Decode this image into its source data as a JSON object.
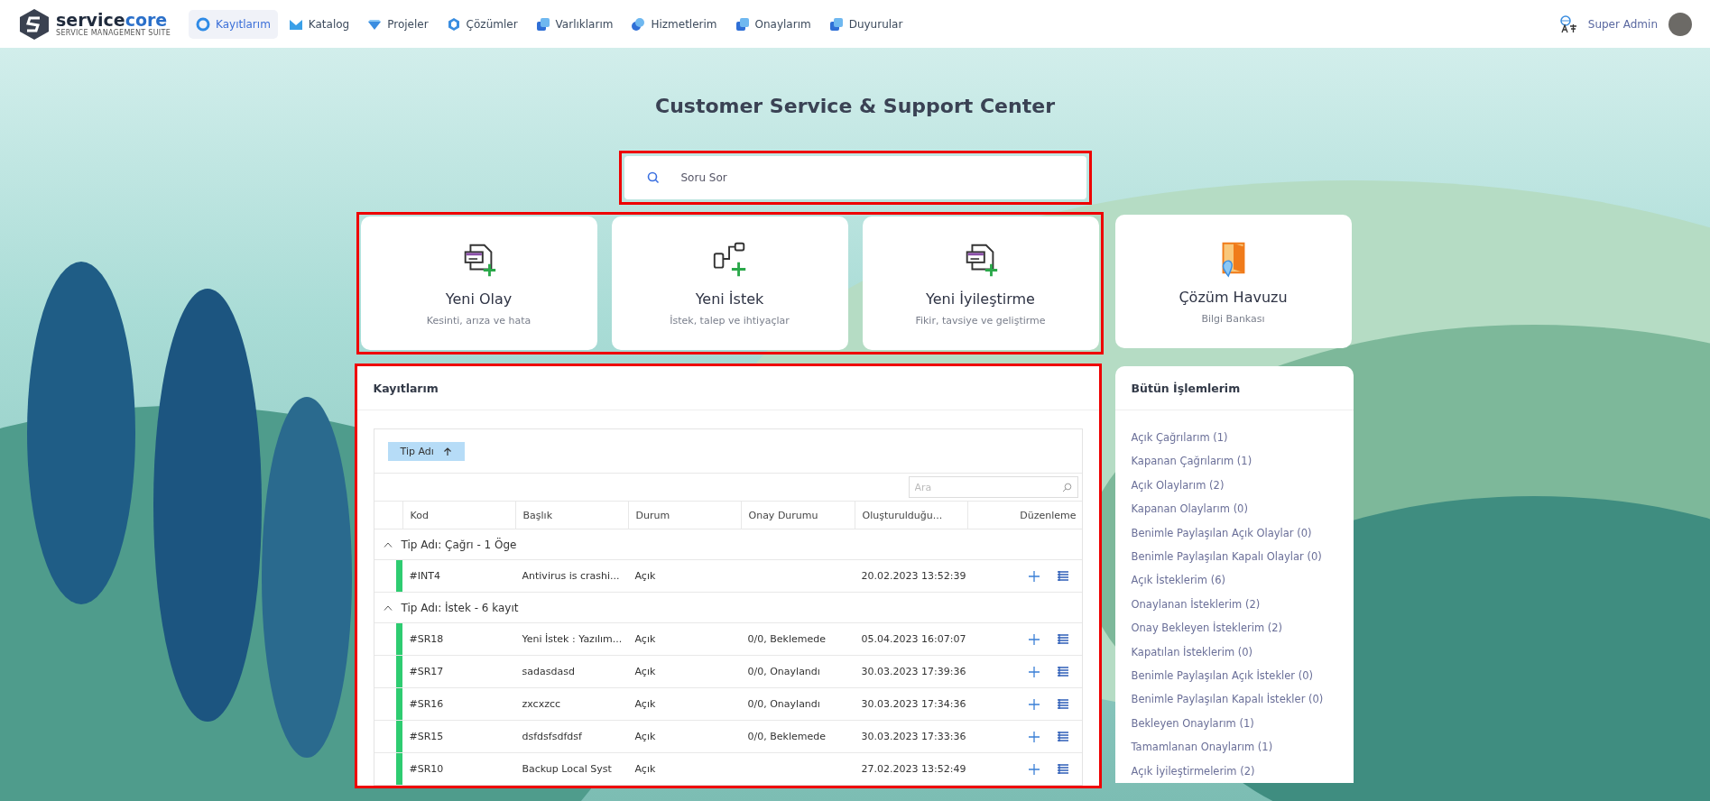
{
  "brand": {
    "name_a": "service",
    "name_b": "core",
    "tagline": "SERVICE MANAGEMENT SUITE"
  },
  "nav": [
    {
      "label": "Kayıtlarım",
      "selected": true,
      "kind": "ring"
    },
    {
      "label": "Katalog",
      "selected": false,
      "kind": "envelope"
    },
    {
      "label": "Projeler",
      "selected": false,
      "kind": "diamond"
    },
    {
      "label": "Çözümler",
      "selected": false,
      "kind": "hexagon"
    },
    {
      "label": "Varlıklarım",
      "selected": false,
      "kind": "stack"
    },
    {
      "label": "Hizmetlerim",
      "selected": false,
      "kind": "drops"
    },
    {
      "label": "Onaylarım",
      "selected": false,
      "kind": "stack"
    },
    {
      "label": "Duyurular",
      "selected": false,
      "kind": "stack"
    }
  ],
  "user": {
    "name": "Super Admin"
  },
  "title": "Customer Service & Support Center",
  "search": {
    "placeholder": "Soru Sor",
    "highlighted": true
  },
  "cards_highlighted": true,
  "cards": [
    {
      "title": "Yeni Olay",
      "subtitle": "Kesinti, arıza ve hata",
      "kind": "form"
    },
    {
      "title": "Yeni İstek",
      "subtitle": "İstek, talep ve ihtiyaçlar",
      "kind": "flow"
    },
    {
      "title": "Yeni İyileştirme",
      "subtitle": "Fikir, tavsiye ve geliştirme",
      "kind": "form"
    },
    {
      "title": "Çözüm Havuzu",
      "subtitle": "Bilgi Bankası",
      "kind": "folder"
    }
  ],
  "records": {
    "title": "Kayıtlarım",
    "highlighted": true,
    "group_chip": "Tip Adı",
    "grid_search": {
      "placeholder": "Ara"
    },
    "columns": [
      "Kod",
      "Başlık",
      "Durum",
      "Onay Durumu",
      "Oluşturulduğu...",
      "Düzenleme"
    ],
    "groups": [
      {
        "label": "Tip Adı: Çağrı - 1 Öge",
        "expanded": true,
        "rows": [
          {
            "code": "#INT4",
            "title": "Antivirus is crashi...",
            "status": "Açık",
            "approval": "",
            "created": "20.02.2023 13:52:39",
            "color": "#2ecc71"
          }
        ]
      },
      {
        "label": "Tip Adı: İstek - 6 kayıt",
        "expanded": true,
        "rows": [
          {
            "code": "#SR18",
            "title": "Yeni İstek : Yazılım...",
            "status": "Açık",
            "approval": "0/0, Beklemede",
            "created": "05.04.2023 16:07:07",
            "color": "#2ecc71"
          },
          {
            "code": "#SR17",
            "title": "sadasdasd",
            "status": "Açık",
            "approval": "0/0, Onaylandı",
            "created": "30.03.2023 17:39:36",
            "color": "#2ecc71"
          },
          {
            "code": "#SR16",
            "title": "zxcxzcc",
            "status": "Açık",
            "approval": "0/0, Onaylandı",
            "created": "30.03.2023 17:34:36",
            "color": "#2ecc71"
          },
          {
            "code": "#SR15",
            "title": "dsfdsfsdfdsf",
            "status": "Açık",
            "approval": "0/0, Beklemede",
            "created": "30.03.2023 17:33:36",
            "color": "#2ecc71"
          },
          {
            "code": "#SR10",
            "title": "Backup Local Syst",
            "status": "Açık",
            "approval": "",
            "created": "27.02.2023 13:52:49",
            "color": "#2ecc71"
          }
        ]
      }
    ]
  },
  "actions": {
    "title": "Bütün İşlemlerim",
    "items": [
      "Açık Çağrılarım (1)",
      "Kapanan Çağrılarım (1)",
      "Açık Olaylarım (2)",
      "Kapanan Olaylarım (0)",
      "Benimle Paylaşılan Açık Olaylar (0)",
      "Benimle Paylaşılan Kapalı Olaylar (0)",
      "Açık İsteklerim (6)",
      "Onaylanan İsteklerim (2)",
      "Onay Bekleyen İsteklerim (2)",
      "Kapatılan İsteklerim (0)",
      "Benimle Paylaşılan Açık İstekler (0)",
      "Benimle Paylaşılan Kapalı İstekler (0)",
      "Bekleyen Onaylarım (1)",
      "Tamamlanan Onaylarım (1)",
      "Açık İyileştirmelerim (2)"
    ]
  }
}
